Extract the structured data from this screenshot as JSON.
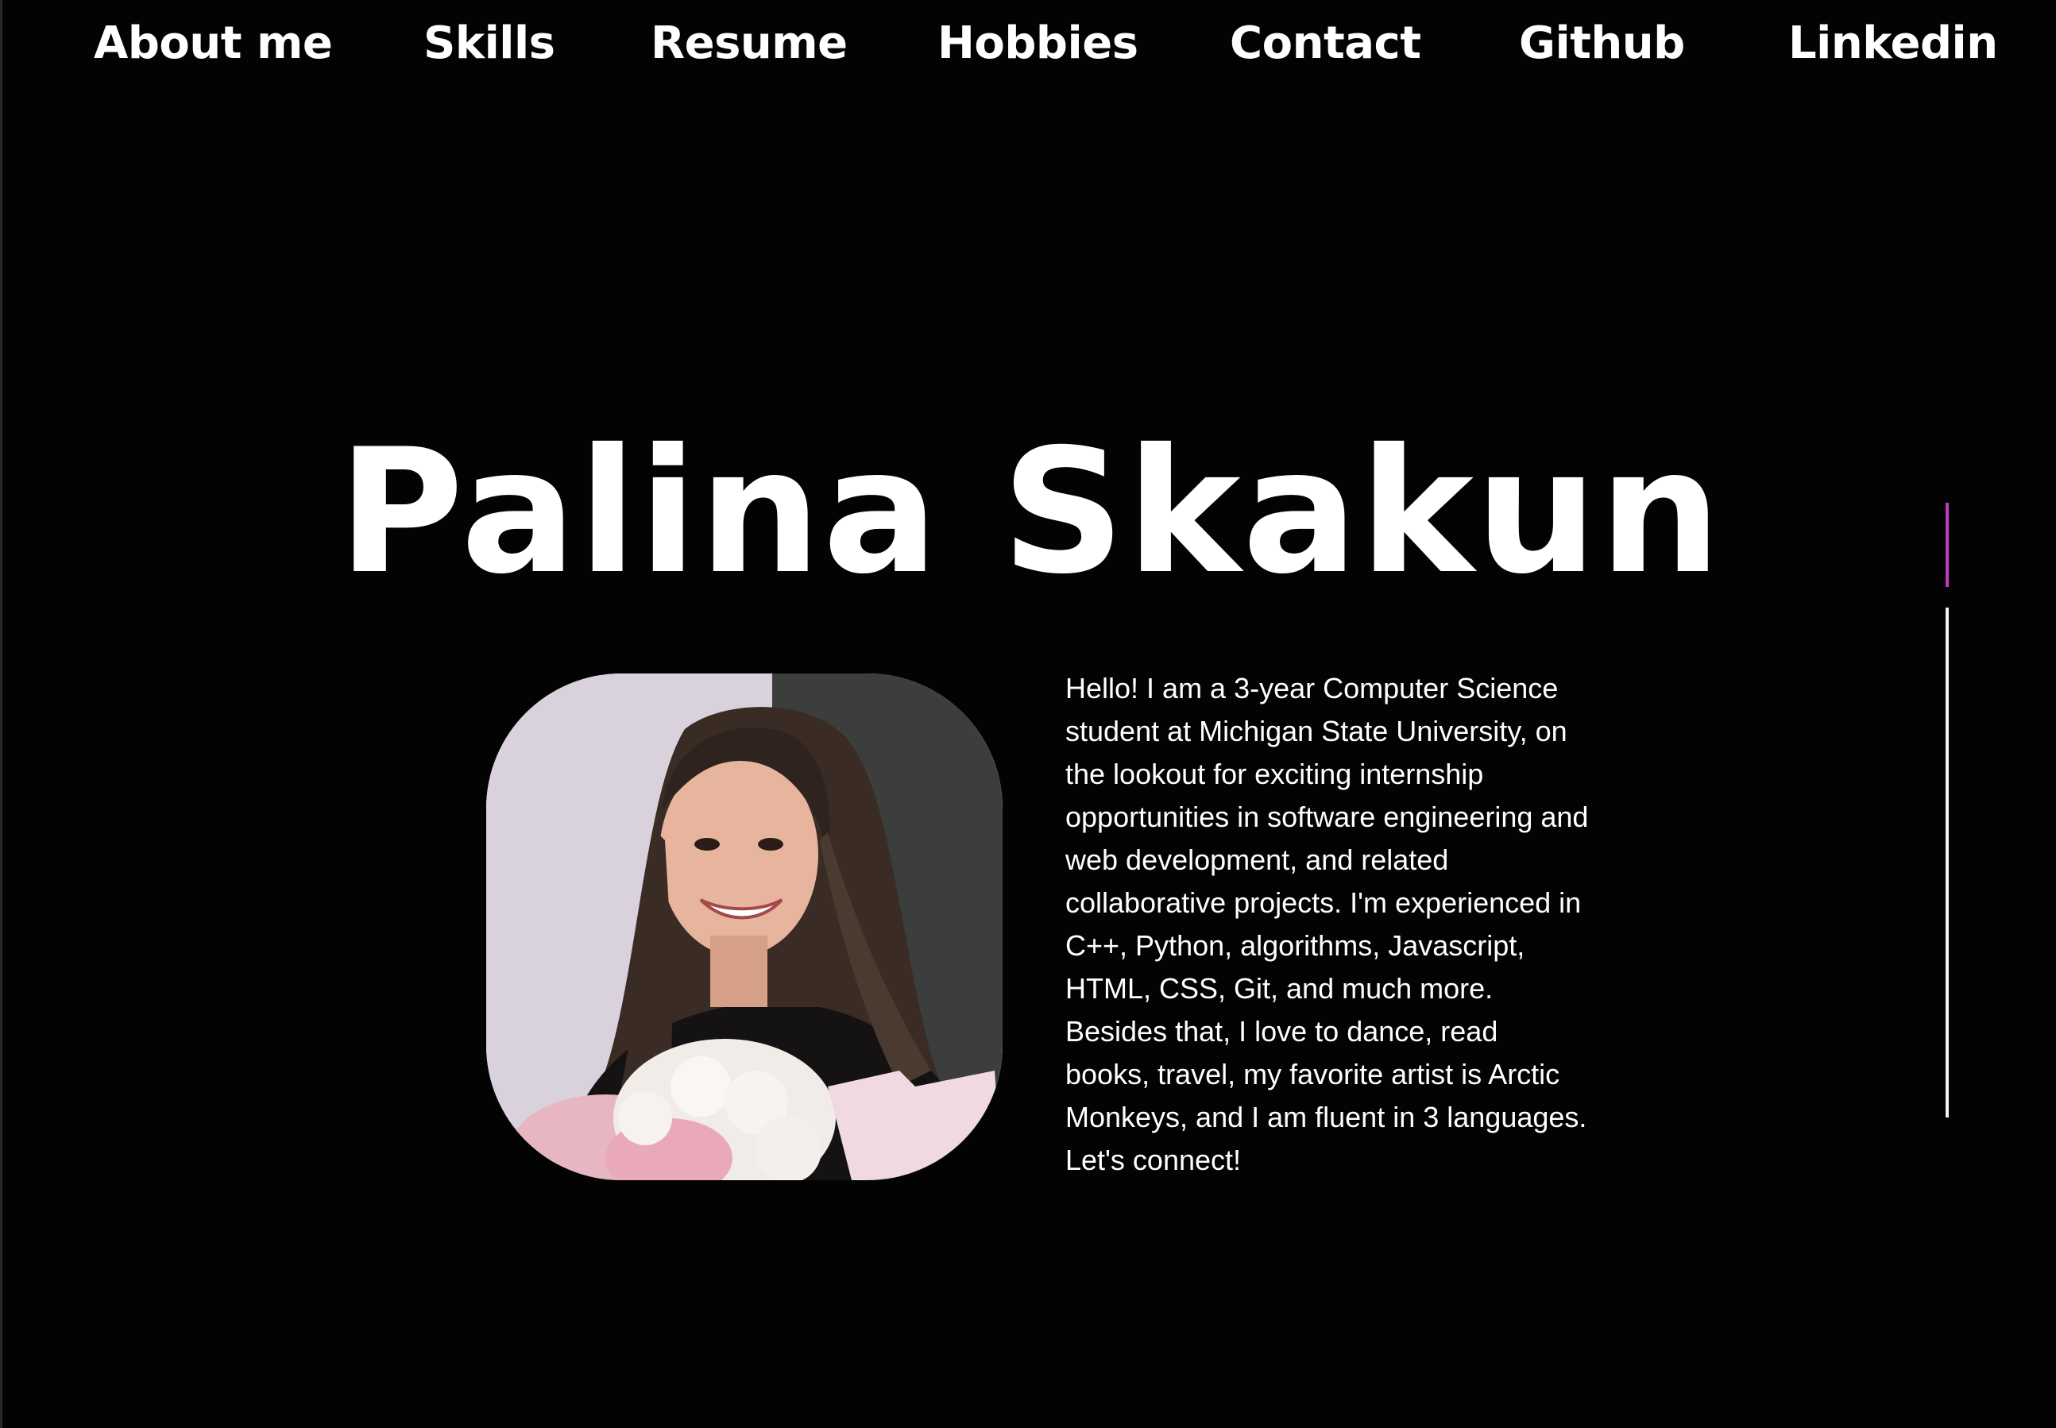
{
  "nav": {
    "items": [
      {
        "label": "About me"
      },
      {
        "label": "Skills"
      },
      {
        "label": "Resume"
      },
      {
        "label": "Hobbies"
      },
      {
        "label": "Contact"
      },
      {
        "label": "Github"
      },
      {
        "label": "Linkedin"
      }
    ]
  },
  "hero": {
    "name": "Palina Skakun",
    "bio": "Hello! I am a 3-year Computer Science student at Michigan State University, on the lookout for exciting internship opportunities in software engineering and web development, and related collaborative projects. I'm experienced in C++, Python, algorithms, Javascript, HTML, CSS, Git, and much more. Besides that, I love to dance, read books, travel, my favorite artist is Arctic Monkeys, and I am fluent in 3 languages. Let's connect!"
  },
  "colors": {
    "background": "#030303",
    "text": "#ffffff",
    "scroll_thumb": "#c23bbd",
    "scroll_track": "#f2f2f2"
  }
}
